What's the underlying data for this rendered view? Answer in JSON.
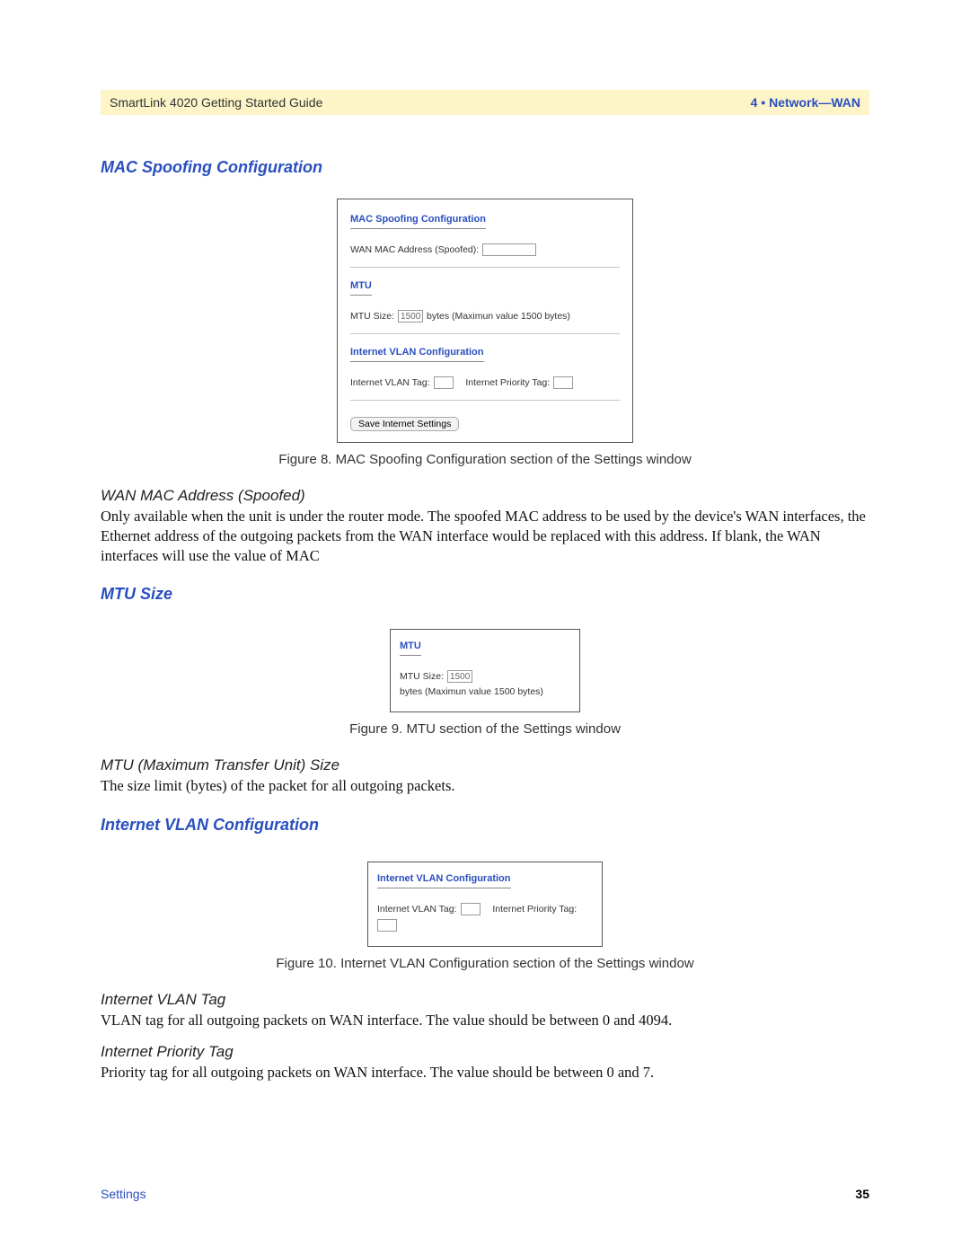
{
  "header": {
    "left": "SmartLink 4020 Getting Started Guide",
    "right": "4 • Network—WAN"
  },
  "sections": {
    "mac": {
      "heading": "MAC Spoofing Configuration",
      "figure": {
        "panel_mac_title": "MAC Spoofing Configuration",
        "wan_mac_label": "WAN MAC Address (Spoofed):",
        "panel_mtu_title": "MTU",
        "mtu_size_label": "MTU Size:",
        "mtu_value": "1500",
        "mtu_note": "bytes (Maximun value 1500 bytes)",
        "panel_vlan_title": "Internet VLAN Configuration",
        "vlan_tag_label": "Internet VLAN Tag:",
        "priority_tag_label": "Internet Priority Tag:",
        "save_button": "Save Internet Settings",
        "caption": "Figure 8. MAC Spoofing Configuration section of the Settings window"
      },
      "wan_subhead": "WAN MAC Address (Spoofed)",
      "wan_body": "Only available when the unit is under the router mode. The spoofed MAC address to be used by the device's WAN interfaces, the Ethernet address of the outgoing packets from the WAN interface would be replaced with this address. If blank, the WAN interfaces will use the value of MAC"
    },
    "mtu": {
      "heading": "MTU Size",
      "figure": {
        "panel_title": "MTU",
        "mtu_size_label": "MTU Size:",
        "mtu_value": "1500",
        "mtu_note": "bytes (Maximun value 1500 bytes)",
        "caption": "Figure 9. MTU section of the Settings window"
      },
      "mtu_subhead": "MTU (Maximum Transfer Unit) Size",
      "mtu_body": "The size limit (bytes) of the packet for all outgoing packets."
    },
    "vlan": {
      "heading": "Internet VLAN Configuration",
      "figure": {
        "panel_title": "Internet VLAN Configuration",
        "vlan_tag_label": "Internet VLAN Tag:",
        "priority_tag_label": "Internet Priority Tag:",
        "caption": "Figure 10. Internet VLAN Configuration section of the Settings window"
      },
      "vlan_tag_subhead": "Internet VLAN Tag",
      "vlan_tag_body": "VLAN tag for all outgoing packets on WAN interface. The value should be between 0 and 4094.",
      "priority_subhead": "Internet Priority Tag",
      "priority_body": "Priority tag for all outgoing packets on WAN interface. The value should be between 0 and 7."
    }
  },
  "footer": {
    "left": "Settings",
    "right": "35"
  }
}
